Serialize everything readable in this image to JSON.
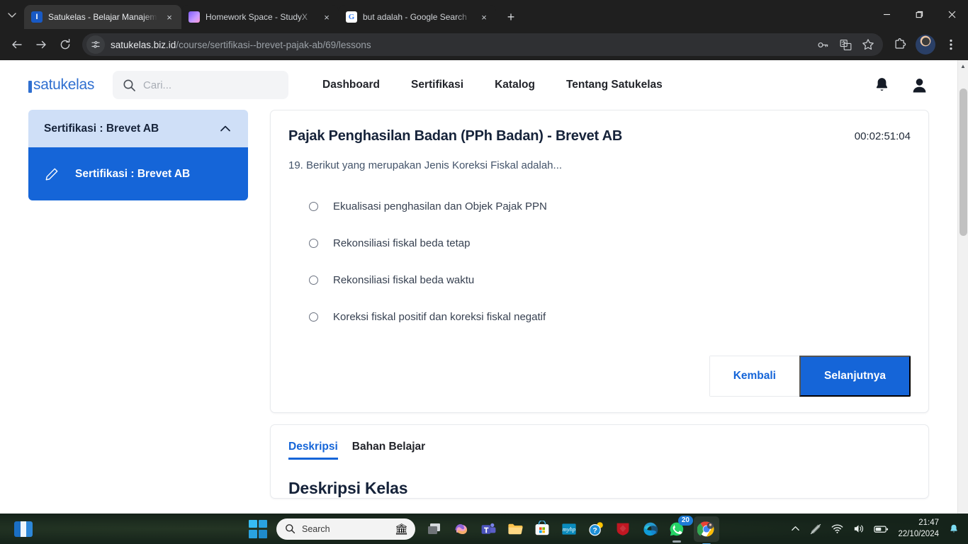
{
  "browser": {
    "tabs": [
      {
        "title": "Satukelas - Belajar Manajemen",
        "favicon": "satukelas-icon",
        "active": true
      },
      {
        "title": "Homework Space - StudyX",
        "favicon": "studyx-icon",
        "active": false
      },
      {
        "title": "but adalah - Google Search",
        "favicon": "google-icon",
        "active": false
      }
    ],
    "new_tab_label": "+",
    "close_label": "×",
    "window_controls": {
      "minimize": "—",
      "maximize": "❐",
      "close": "✕"
    },
    "url_domain": "satukelas.biz.id",
    "url_path": "/course/sertifikasi--brevet-pajak-ab/69/lessons",
    "toolbar_icons": [
      "password-key-icon",
      "translate-icon",
      "bookmark-star-icon",
      "extensions-icon",
      "profile-avatar",
      "chrome-menu-icon"
    ],
    "nav_icons": [
      "back-icon",
      "forward-icon",
      "reload-icon"
    ]
  },
  "site": {
    "logo": "satukelas",
    "search": {
      "placeholder": "Cari...",
      "value": ""
    },
    "nav": [
      "Dashboard",
      "Sertifikasi",
      "Katalog",
      "Tentang Satukelas"
    ],
    "header_icons": [
      "notification-bell-icon",
      "user-account-icon"
    ]
  },
  "sidebar": {
    "accordion_title": "Sertifikasi : Brevet AB",
    "accordion_state": "expanded",
    "items": [
      {
        "label": "Sertifikasi : Brevet AB",
        "icon": "pencil-icon",
        "active": true
      }
    ]
  },
  "quiz": {
    "title": "Pajak Penghasilan Badan (PPh Badan) - Brevet AB",
    "timer": "00:02:51:04",
    "question_number": "19.",
    "question": "19. Berikut yang merupakan Jenis Koreksi Fiskal adalah...",
    "options": [
      {
        "label": "Ekualisasi penghasilan dan Objek Pajak PPN",
        "selected": false
      },
      {
        "label": "Rekonsiliasi fiskal beda tetap",
        "selected": false
      },
      {
        "label": "Rekonsiliasi fiskal beda waktu",
        "selected": false
      },
      {
        "label": "Koreksi fiskal positif dan koreksi fiskal negatif",
        "selected": false
      }
    ],
    "back_button": "Kembali",
    "next_button": "Selanjutnya"
  },
  "description_panel": {
    "tabs": [
      {
        "label": "Deskripsi",
        "active": true
      },
      {
        "label": "Bahan Belajar",
        "active": false
      }
    ],
    "heading": "Deskripsi Kelas"
  },
  "taskbar": {
    "search_placeholder": "Search",
    "time": "21:47",
    "date": "22/10/2024",
    "apps": [
      "task-view-icon",
      "copilot-icon",
      "teams-icon",
      "file-explorer-icon",
      "microsoft-store-icon",
      "myhp-icon",
      "help-icon",
      "mcafee-icon",
      "edge-icon",
      "whatsapp-icon",
      "chrome-icon"
    ],
    "whatsapp_badge": "20",
    "tray_icons": [
      "show-hidden-icons-icon",
      "no-pen-icon",
      "wifi-icon",
      "volume-icon",
      "battery-icon",
      "notification-bell-icon"
    ]
  },
  "colors": {
    "brand_blue": "#1565d8",
    "accent_light_blue": "#cfdff7",
    "text_dark": "#16233a"
  }
}
